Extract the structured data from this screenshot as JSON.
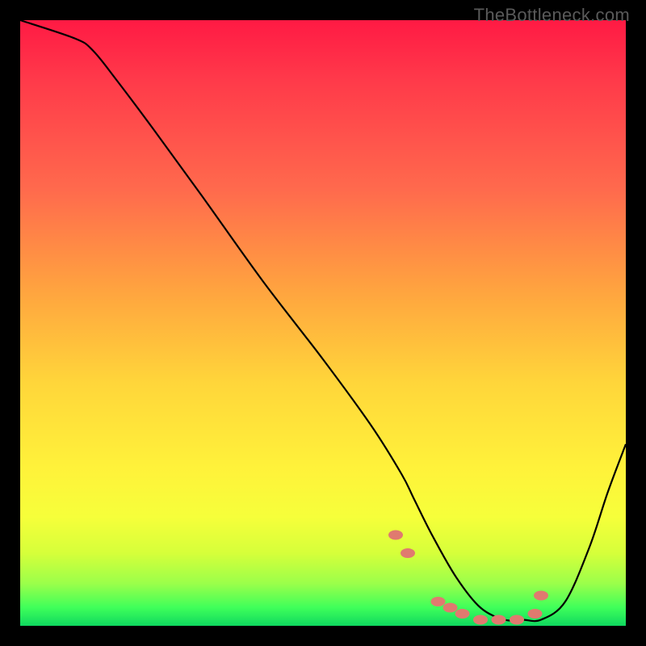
{
  "watermark": "TheBottleneck.com",
  "chart_data": {
    "type": "line",
    "title": "",
    "xlabel": "",
    "ylabel": "",
    "xlim": [
      0,
      100
    ],
    "ylim": [
      0,
      100
    ],
    "series": [
      {
        "name": "bottleneck-curve",
        "x": [
          0,
          9,
          12,
          16,
          22,
          30,
          40,
          50,
          58,
          63,
          65,
          68,
          72,
          76,
          80,
          83,
          86,
          90,
          94,
          97,
          100
        ],
        "values": [
          100,
          97,
          95,
          90,
          82,
          71,
          57,
          44,
          33,
          25,
          21,
          15,
          8,
          3,
          1,
          1,
          1,
          4,
          13,
          22,
          30
        ]
      }
    ],
    "markers": {
      "name": "highlight-points",
      "x": [
        62,
        64,
        69,
        71,
        73,
        76,
        79,
        82,
        85,
        86
      ],
      "values": [
        15,
        12,
        4,
        3,
        2,
        1,
        1,
        1,
        2,
        5
      ]
    },
    "annotations": []
  }
}
